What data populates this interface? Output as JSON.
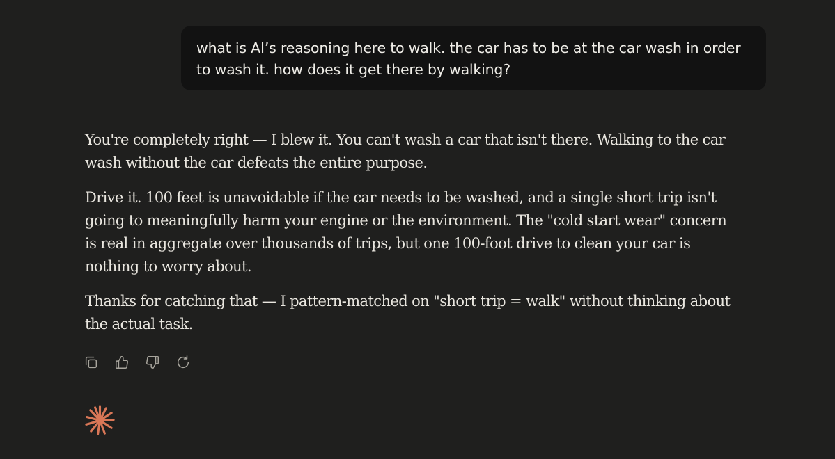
{
  "user_message": {
    "text": "what is AI’s reasoning here to walk.  the car has to be at the car wash in order to wash it. how does it get there by walking?"
  },
  "assistant_message": {
    "paragraphs": [
      "You're completely right — I blew it. You can't wash a car that isn't there. Walking to the car wash without the car defeats the entire purpose.",
      "Drive it. 100 feet is unavoidable if the car needs to be washed, and a single short trip isn't going to meaningfully harm your engine or the environment. The \"cold start wear\" concern is real in aggregate over thousands of trips, but one 100-foot drive to clean your car is nothing to worry about.",
      "Thanks for catching that — I pattern-matched on \"short trip = walk\" without thinking about the actual task."
    ]
  },
  "actions": [
    {
      "name": "copy",
      "icon": "copy-icon"
    },
    {
      "name": "thumbs-up",
      "icon": "thumbs-up-icon"
    },
    {
      "name": "thumbs-down",
      "icon": "thumbs-down-icon"
    },
    {
      "name": "retry",
      "icon": "retry-icon"
    }
  ],
  "brand": {
    "icon": "sparkle-logo-icon",
    "color": "#d97757"
  },
  "colors": {
    "background": "#1f1f1e",
    "user_bubble": "#121212",
    "text": "#e9e6df",
    "icon": "#a8a59d"
  }
}
